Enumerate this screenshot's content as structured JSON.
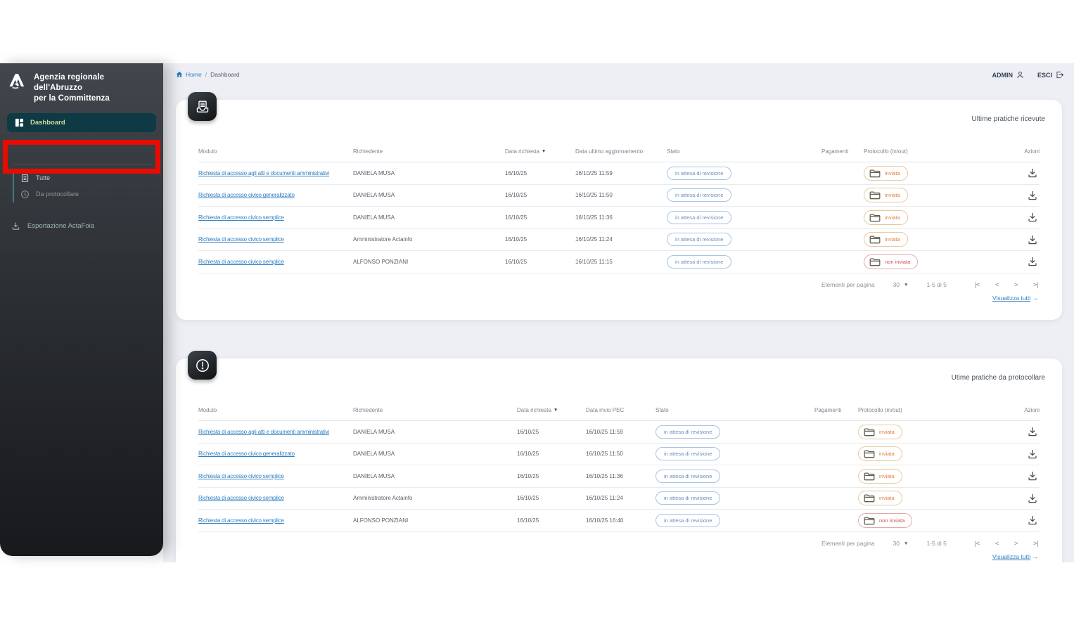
{
  "colors": {
    "annotation_red": "#e90b00",
    "link_blue": "#2f7fc1",
    "status_blue_border": "#a6c4e6",
    "sent_orange": "#e0823f",
    "not_sent_red": "#d05050",
    "sidebar_accent_teal": "#0d3a44"
  },
  "annotation": {
    "highlight_box_color": "#e90b00",
    "highlighted_item": "Tutte"
  },
  "sidebar": {
    "agency_name_line1": "Agenzia regionale dell'Abruzzo",
    "agency_name_line2": "per la Committenza",
    "dashboard_label": "Dashboard",
    "nav": [
      {
        "label": "Tutte",
        "icon": "document-list-icon"
      },
      {
        "label": "Da protocollare",
        "icon": "clock-icon"
      }
    ],
    "export_label": "Esportazione ActaFoia",
    "export_icon": "download-icon"
  },
  "topbar": {
    "breadcrumb_home": "Home",
    "breadcrumb_separator": "/",
    "breadcrumb_current": "Dashboard",
    "user_label": "ADMIN",
    "user_icon": "person-icon",
    "logout_label": "ESCI",
    "logout_icon": "logout-icon"
  },
  "cards": [
    {
      "icon": "inbox-document-icon",
      "title": "Ultime pratiche ricevute",
      "columns": [
        "Modulo",
        "Richiedente",
        "Data richiesta",
        "Data ultimo aggiornamento",
        "Stato",
        "Pagamenti",
        "Protocollo (in/out)",
        "Azioni"
      ],
      "sort_column_index": 2,
      "sort_icon": "sort-desc-caret",
      "rows": [
        {
          "modulo": "Richiesta di accesso agli atti e documenti amministrativi",
          "richiedente": "DANIELA MUSA",
          "data_richiesta": "16/10/25",
          "data_col": "16/10/25 11:59",
          "stato": "in attesa di revisione",
          "pagamenti": "",
          "protocollo": "inviata",
          "protocollo_state": "sent"
        },
        {
          "modulo": "Richiesta di accesso civico generalizzato",
          "richiedente": "DANIELA MUSA",
          "data_richiesta": "16/10/25",
          "data_col": "16/10/25 11:50",
          "stato": "in attesa di revisione",
          "pagamenti": "",
          "protocollo": "inviata",
          "protocollo_state": "sent"
        },
        {
          "modulo": "Richiesta di accesso civico semplice",
          "richiedente": "DANIELA MUSA",
          "data_richiesta": "16/10/25",
          "data_col": "16/10/25 11:36",
          "stato": "in attesa di revisione",
          "pagamenti": "",
          "protocollo": "inviata",
          "protocollo_state": "sent"
        },
        {
          "modulo": "Richiesta di accesso civico semplice",
          "richiedente": "Amministratore Actainfo",
          "data_richiesta": "16/10/25",
          "data_col": "16/10/25 11:24",
          "stato": "in attesa di revisione",
          "pagamenti": "",
          "protocollo": "inviata",
          "protocollo_state": "sent"
        },
        {
          "modulo": "Richiesta di accesso civico semplice",
          "richiedente": "ALFONSO PONZIANI",
          "data_richiesta": "16/10/25",
          "data_col": "16/10/25 11:15",
          "stato": "in attesa di revisione",
          "pagamenti": "",
          "protocollo": "non inviata",
          "protocollo_state": "not-sent"
        }
      ],
      "pagination": {
        "items_per_page_label": "Elementi per pagina",
        "items_per_page_value": "30",
        "range": "1-5 di 5",
        "first": "|<",
        "prev": "<",
        "next": ">",
        "last": ">|"
      },
      "view_all_label": "Visualizza tutti",
      "view_all_arrow": "→"
    },
    {
      "icon": "alert-circle-icon",
      "title": "Utime pratiche da protocollare",
      "columns": [
        "Modulo",
        "Richiedente",
        "Data richiesta",
        "Data invio PEC",
        "Stato",
        "Pagamenti",
        "Protocollo (in/out)",
        "Azioni"
      ],
      "sort_column_index": 2,
      "sort_icon": "sort-desc-caret",
      "rows": [
        {
          "modulo": "Richiesta di accesso agli atti e documenti amministrativi",
          "richiedente": "DANIELA MUSA",
          "data_richiesta": "16/10/25",
          "data_col": "16/10/25 11:59",
          "stato": "in attesa di revisione",
          "pagamenti": "",
          "protocollo": "inviata",
          "protocollo_state": "sent"
        },
        {
          "modulo": "Richiesta di accesso civico generalizzato",
          "richiedente": "DANIELA MUSA",
          "data_richiesta": "16/10/25",
          "data_col": "16/10/25 11:50",
          "stato": "in attesa di revisione",
          "pagamenti": "",
          "protocollo": "inviata",
          "protocollo_state": "sent"
        },
        {
          "modulo": "Richiesta di accesso civico semplice",
          "richiedente": "DANIELA MUSA",
          "data_richiesta": "16/10/25",
          "data_col": "16/10/25 11:36",
          "stato": "in attesa di revisione",
          "pagamenti": "",
          "protocollo": "inviata",
          "protocollo_state": "sent"
        },
        {
          "modulo": "Richiesta di accesso civico semplice",
          "richiedente": "Amministratore Actainfo",
          "data_richiesta": "16/10/25",
          "data_col": "16/10/25 11:24",
          "stato": "in attesa di revisione",
          "pagamenti": "",
          "protocollo": "inviata",
          "protocollo_state": "sent"
        },
        {
          "modulo": "Richiesta di accesso civico semplice",
          "richiedente": "ALFONSO PONZIANI",
          "data_richiesta": "16/10/25",
          "data_col": "16/10/25 16:40",
          "stato": "in attesa di revisione",
          "pagamenti": "",
          "protocollo": "non inviata",
          "protocollo_state": "not-sent"
        }
      ],
      "pagination": {
        "items_per_page_label": "Elementi per pagina",
        "items_per_page_value": "30",
        "range": "1-5 di 5",
        "first": "|<",
        "prev": "<",
        "next": ">",
        "last": ">|"
      },
      "view_all_label": "Visualizza tutti",
      "view_all_arrow": "→"
    }
  ]
}
